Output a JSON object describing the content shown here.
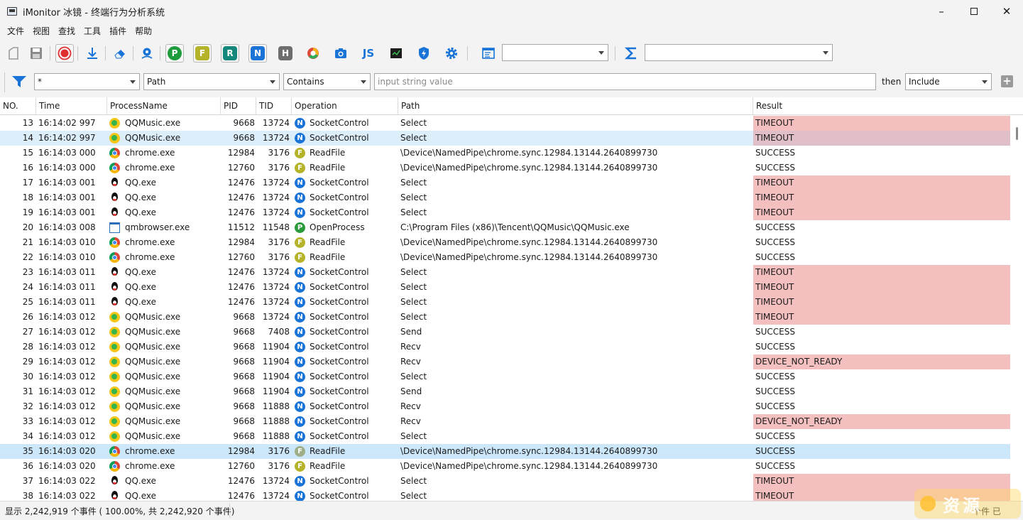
{
  "window": {
    "title": "iMonitor 冰镜 - 终端行为分析系统"
  },
  "menu": [
    "文件",
    "视图",
    "查找",
    "工具",
    "插件",
    "帮助"
  ],
  "toolbar": {
    "badges": {
      "p": "P",
      "f": "F",
      "r": "R",
      "n": "N",
      "h": "H",
      "js": "JS"
    },
    "combo1_value": "",
    "combo2_value": ""
  },
  "filter": {
    "process": "*",
    "field": "Path",
    "condition": "Contains",
    "value_placeholder": "input string value",
    "then_label": "then",
    "action": "Include"
  },
  "columns": [
    "NO.",
    "Time",
    "ProcessName",
    "PID",
    "TID",
    "Operation",
    "Path",
    "Result"
  ],
  "rows": [
    {
      "no": "13",
      "time": "16:14:02 997",
      "proc": "QQMusic.exe",
      "icon": "qqmusic",
      "pid": "9668",
      "tid": "13724",
      "opc": "N",
      "op": "SocketControl",
      "path": "Select",
      "res": "TIMEOUT",
      "bad": true
    },
    {
      "no": "14",
      "time": "16:14:02 997",
      "proc": "QQMusic.exe",
      "icon": "qqmusic",
      "pid": "9668",
      "tid": "13724",
      "opc": "N",
      "op": "SocketControl",
      "path": "Select",
      "res": "TIMEOUT",
      "bad": true,
      "sel": "light"
    },
    {
      "no": "15",
      "time": "16:14:03 000",
      "proc": "chrome.exe",
      "icon": "chrome",
      "pid": "12984",
      "tid": "3176",
      "opc": "F",
      "op": "ReadFile",
      "path": "\\Device\\NamedPipe\\chrome.sync.12984.13144.2640899730",
      "res": "SUCCESS",
      "bad": false
    },
    {
      "no": "16",
      "time": "16:14:03 000",
      "proc": "chrome.exe",
      "icon": "chrome",
      "pid": "12760",
      "tid": "3176",
      "opc": "F",
      "op": "ReadFile",
      "path": "\\Device\\NamedPipe\\chrome.sync.12984.13144.2640899730",
      "res": "SUCCESS",
      "bad": false
    },
    {
      "no": "17",
      "time": "16:14:03 001",
      "proc": "QQ.exe",
      "icon": "qq",
      "pid": "12476",
      "tid": "13724",
      "opc": "N",
      "op": "SocketControl",
      "path": "Select",
      "res": "TIMEOUT",
      "bad": true
    },
    {
      "no": "18",
      "time": "16:14:03 001",
      "proc": "QQ.exe",
      "icon": "qq",
      "pid": "12476",
      "tid": "13724",
      "opc": "N",
      "op": "SocketControl",
      "path": "Select",
      "res": "TIMEOUT",
      "bad": true
    },
    {
      "no": "19",
      "time": "16:14:03 001",
      "proc": "QQ.exe",
      "icon": "qq",
      "pid": "12476",
      "tid": "13724",
      "opc": "N",
      "op": "SocketControl",
      "path": "Select",
      "res": "TIMEOUT",
      "bad": true
    },
    {
      "no": "20",
      "time": "16:14:03 008",
      "proc": "qmbrowser.exe",
      "icon": "qmb",
      "pid": "11512",
      "tid": "11548",
      "opc": "P",
      "op": "OpenProcess",
      "path": "C:\\Program Files (x86)\\Tencent\\QQMusic\\QQMusic.exe",
      "res": "SUCCESS",
      "bad": false
    },
    {
      "no": "21",
      "time": "16:14:03 010",
      "proc": "chrome.exe",
      "icon": "chrome",
      "pid": "12984",
      "tid": "3176",
      "opc": "F",
      "op": "ReadFile",
      "path": "\\Device\\NamedPipe\\chrome.sync.12984.13144.2640899730",
      "res": "SUCCESS",
      "bad": false
    },
    {
      "no": "22",
      "time": "16:14:03 010",
      "proc": "chrome.exe",
      "icon": "chrome",
      "pid": "12760",
      "tid": "3176",
      "opc": "F",
      "op": "ReadFile",
      "path": "\\Device\\NamedPipe\\chrome.sync.12984.13144.2640899730",
      "res": "SUCCESS",
      "bad": false
    },
    {
      "no": "23",
      "time": "16:14:03 011",
      "proc": "QQ.exe",
      "icon": "qq",
      "pid": "12476",
      "tid": "13724",
      "opc": "N",
      "op": "SocketControl",
      "path": "Select",
      "res": "TIMEOUT",
      "bad": true
    },
    {
      "no": "24",
      "time": "16:14:03 011",
      "proc": "QQ.exe",
      "icon": "qq",
      "pid": "12476",
      "tid": "13724",
      "opc": "N",
      "op": "SocketControl",
      "path": "Select",
      "res": "TIMEOUT",
      "bad": true
    },
    {
      "no": "25",
      "time": "16:14:03 011",
      "proc": "QQ.exe",
      "icon": "qq",
      "pid": "12476",
      "tid": "13724",
      "opc": "N",
      "op": "SocketControl",
      "path": "Select",
      "res": "TIMEOUT",
      "bad": true
    },
    {
      "no": "26",
      "time": "16:14:03 012",
      "proc": "QQMusic.exe",
      "icon": "qqmusic",
      "pid": "9668",
      "tid": "13724",
      "opc": "N",
      "op": "SocketControl",
      "path": "Select",
      "res": "TIMEOUT",
      "bad": true
    },
    {
      "no": "27",
      "time": "16:14:03 012",
      "proc": "QQMusic.exe",
      "icon": "qqmusic",
      "pid": "9668",
      "tid": "7408",
      "opc": "N",
      "op": "SocketControl",
      "path": "Send",
      "res": "SUCCESS",
      "bad": false
    },
    {
      "no": "28",
      "time": "16:14:03 012",
      "proc": "QQMusic.exe",
      "icon": "qqmusic",
      "pid": "9668",
      "tid": "11904",
      "opc": "N",
      "op": "SocketControl",
      "path": "Recv",
      "res": "SUCCESS",
      "bad": false
    },
    {
      "no": "29",
      "time": "16:14:03 012",
      "proc": "QQMusic.exe",
      "icon": "qqmusic",
      "pid": "9668",
      "tid": "11904",
      "opc": "N",
      "op": "SocketControl",
      "path": "Recv",
      "res": "DEVICE_NOT_READY",
      "bad": true
    },
    {
      "no": "30",
      "time": "16:14:03 012",
      "proc": "QQMusic.exe",
      "icon": "qqmusic",
      "pid": "9668",
      "tid": "11904",
      "opc": "N",
      "op": "SocketControl",
      "path": "Select",
      "res": "SUCCESS",
      "bad": false
    },
    {
      "no": "31",
      "time": "16:14:03 012",
      "proc": "QQMusic.exe",
      "icon": "qqmusic",
      "pid": "9668",
      "tid": "11904",
      "opc": "N",
      "op": "SocketControl",
      "path": "Send",
      "res": "SUCCESS",
      "bad": false
    },
    {
      "no": "32",
      "time": "16:14:03 012",
      "proc": "QQMusic.exe",
      "icon": "qqmusic",
      "pid": "9668",
      "tid": "11888",
      "opc": "N",
      "op": "SocketControl",
      "path": "Recv",
      "res": "SUCCESS",
      "bad": false
    },
    {
      "no": "33",
      "time": "16:14:03 012",
      "proc": "QQMusic.exe",
      "icon": "qqmusic",
      "pid": "9668",
      "tid": "11888",
      "opc": "N",
      "op": "SocketControl",
      "path": "Recv",
      "res": "DEVICE_NOT_READY",
      "bad": true
    },
    {
      "no": "34",
      "time": "16:14:03 012",
      "proc": "QQMusic.exe",
      "icon": "qqmusic",
      "pid": "9668",
      "tid": "11888",
      "opc": "N",
      "op": "SocketControl",
      "path": "Select",
      "res": "SUCCESS",
      "bad": false
    },
    {
      "no": "35",
      "time": "16:14:03 020",
      "proc": "chrome.exe",
      "icon": "chrome",
      "pid": "12984",
      "tid": "3176",
      "opc": "F",
      "op": "ReadFile",
      "path": "\\Device\\NamedPipe\\chrome.sync.12984.13144.2640899730",
      "res": "SUCCESS",
      "bad": false,
      "sel": "full"
    },
    {
      "no": "36",
      "time": "16:14:03 020",
      "proc": "chrome.exe",
      "icon": "chrome",
      "pid": "12760",
      "tid": "3176",
      "opc": "F",
      "op": "ReadFile",
      "path": "\\Device\\NamedPipe\\chrome.sync.12984.13144.2640899730",
      "res": "SUCCESS",
      "bad": false
    },
    {
      "no": "37",
      "time": "16:14:03 022",
      "proc": "QQ.exe",
      "icon": "qq",
      "pid": "12476",
      "tid": "13724",
      "opc": "N",
      "op": "SocketControl",
      "path": "Select",
      "res": "TIMEOUT",
      "bad": true
    },
    {
      "no": "38",
      "time": "16:14:03 022",
      "proc": "QQ.exe",
      "icon": "qq",
      "pid": "12476",
      "tid": "13724",
      "opc": "N",
      "op": "SocketControl",
      "path": "Select",
      "res": "TIMEOUT",
      "bad": true
    }
  ],
  "status": {
    "summary": "显示 2,242,919 个事件 ( 100.00%, 共 2,242,920 个事件)",
    "right": "个件 已"
  },
  "colors": {
    "timeout_bg": "#f4bfbf",
    "selected_row": "#cce6fa",
    "accent": "#1a74d8"
  }
}
